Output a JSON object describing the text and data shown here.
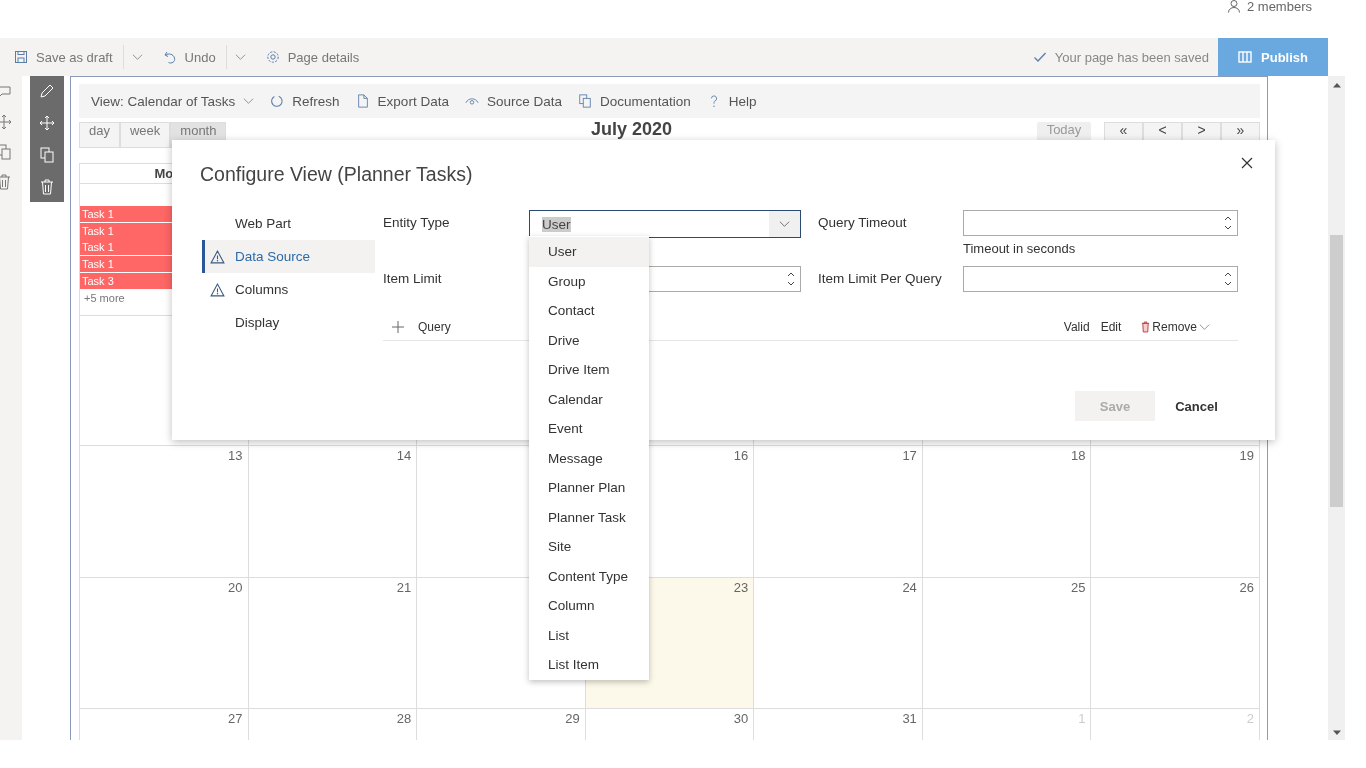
{
  "header": {
    "members": "2 members"
  },
  "page_bar": {
    "save_draft": "Save as draft",
    "undo": "Undo",
    "page_details": "Page details",
    "status": "Your page has been saved",
    "publish": "Publish"
  },
  "webpart": {
    "commands": [
      {
        "kind": "view",
        "label": "View: Calendar of Tasks"
      },
      {
        "kind": "refresh",
        "label": "Refresh"
      },
      {
        "kind": "export",
        "label": "Export Data"
      },
      {
        "kind": "source",
        "label": "Source Data"
      },
      {
        "kind": "docs",
        "label": "Documentation"
      },
      {
        "kind": "help",
        "label": "Help"
      }
    ]
  },
  "calendar": {
    "views": [
      {
        "label": "day",
        "selected": false
      },
      {
        "label": "week",
        "selected": false
      },
      {
        "label": "month",
        "selected": true
      }
    ],
    "title": "July 2020",
    "today": "Today",
    "nav": [
      "«",
      "<",
      ">",
      "»"
    ],
    "columns": [
      "Mo"
    ],
    "weeks": [
      [
        {
          "kind": "blank",
          "events": [
            "Task 1",
            "Task 1",
            "Task 1",
            "Task 1",
            "Task 3"
          ],
          "more": "+5 more"
        }
      ],
      [
        {
          "kind": "blank"
        },
        {
          "kind": "blank"
        },
        {
          "kind": "blank"
        },
        {
          "kind": "blank"
        },
        {
          "kind": "blank"
        },
        {
          "kind": "blank"
        },
        {
          "kind": "blank"
        }
      ],
      [
        {
          "kind": "day",
          "date": "13"
        },
        {
          "kind": "day",
          "date": "14"
        },
        {
          "kind": "blank"
        },
        {
          "kind": "day",
          "date": "16"
        },
        {
          "kind": "day",
          "date": "17"
        },
        {
          "kind": "day",
          "date": "18"
        },
        {
          "kind": "day",
          "date": "19"
        }
      ],
      [
        {
          "kind": "day",
          "date": "20"
        },
        {
          "kind": "day",
          "date": "21"
        },
        {
          "kind": "blank"
        },
        {
          "kind": "today",
          "date": "23"
        },
        {
          "kind": "day",
          "date": "24"
        },
        {
          "kind": "day",
          "date": "25"
        },
        {
          "kind": "day",
          "date": "26"
        }
      ],
      [
        {
          "kind": "day",
          "date": "27"
        },
        {
          "kind": "day",
          "date": "28"
        },
        {
          "kind": "day",
          "date": "29"
        },
        {
          "kind": "day",
          "date": "30"
        },
        {
          "kind": "day",
          "date": "31"
        },
        {
          "kind": "other",
          "date": "1"
        },
        {
          "kind": "other",
          "date": "2"
        }
      ]
    ]
  },
  "dialog": {
    "title": "Configure View (Planner Tasks)",
    "nav": [
      {
        "label": "Web Part",
        "selected": false,
        "warning": false
      },
      {
        "label": "Data Source",
        "selected": true,
        "warning": true
      },
      {
        "label": "Columns",
        "selected": false,
        "warning": true
      },
      {
        "label": "Display",
        "selected": false,
        "warning": false
      }
    ],
    "entity_type": {
      "label": "Entity Type",
      "value": "User"
    },
    "query_timeout": {
      "label": "Query Timeout",
      "description": "Timeout in seconds"
    },
    "item_limit": {
      "label": "Item Limit"
    },
    "item_limit_per_query": {
      "label": "Item Limit Per Query"
    },
    "query": {
      "add": "Query",
      "valid": "Valid",
      "edit": "Edit",
      "remove": "Remove"
    },
    "save": {
      "label": "Save",
      "disabled": true
    },
    "cancel": "Cancel"
  },
  "dropdown": {
    "options": [
      {
        "label": "User",
        "selected": true
      },
      {
        "label": "Group",
        "selected": false
      },
      {
        "label": "Contact",
        "selected": false
      },
      {
        "label": "Drive",
        "selected": false
      },
      {
        "label": "Drive Item",
        "selected": false
      },
      {
        "label": "Calendar",
        "selected": false
      },
      {
        "label": "Event",
        "selected": false
      },
      {
        "label": "Message",
        "selected": false
      },
      {
        "label": "Planner Plan",
        "selected": false
      },
      {
        "label": "Planner Task",
        "selected": false
      },
      {
        "label": "Site",
        "selected": false
      },
      {
        "label": "Content Type",
        "selected": false
      },
      {
        "label": "Column",
        "selected": false
      },
      {
        "label": "List",
        "selected": false
      },
      {
        "label": "List Item",
        "selected": false
      }
    ]
  }
}
